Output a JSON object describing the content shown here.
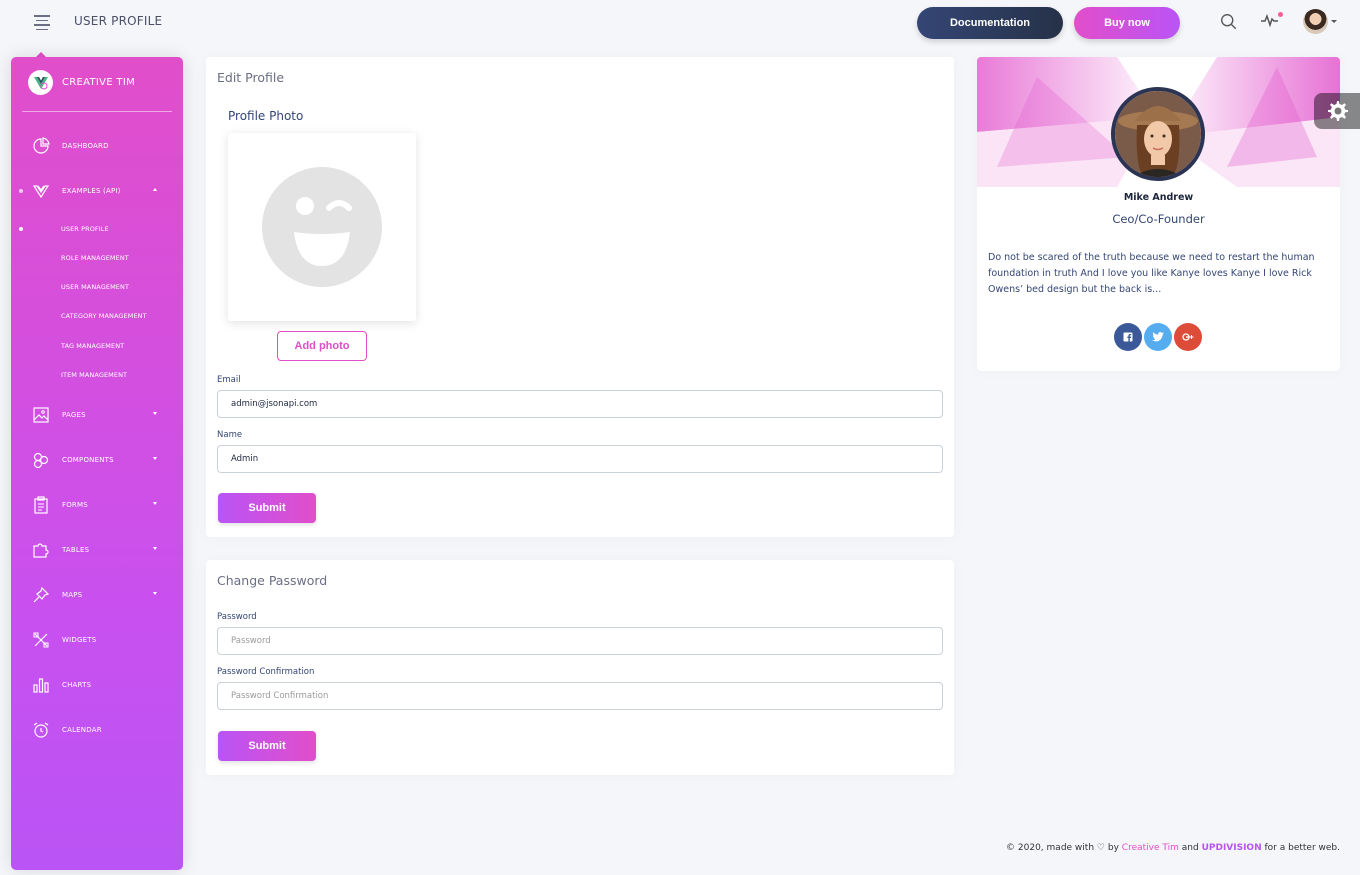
{
  "navbar": {
    "title": "USER PROFILE",
    "documentation_label": "Documentation",
    "buy_label": "Buy now"
  },
  "sidebar": {
    "brand": "CREATIVE TIM",
    "items": [
      {
        "label": "DASHBOARD",
        "icon": "chart-pie-icon"
      },
      {
        "label": "EXAMPLES (API)",
        "icon": "vue-logo-icon"
      },
      {
        "label": "PAGES",
        "icon": "image-icon"
      },
      {
        "label": "COMPONENTS",
        "icon": "components-icon"
      },
      {
        "label": "FORMS",
        "icon": "clipboard-icon"
      },
      {
        "label": "TABLES",
        "icon": "puzzle-icon"
      },
      {
        "label": "MAPS",
        "icon": "pin-icon"
      },
      {
        "label": "WIDGETS",
        "icon": "tools-icon"
      },
      {
        "label": "CHARTS",
        "icon": "bar-chart-icon"
      },
      {
        "label": "CALENDAR",
        "icon": "alarm-clock-icon"
      }
    ],
    "subitems": [
      {
        "label": "USER PROFILE"
      },
      {
        "label": "ROLE MANAGEMENT"
      },
      {
        "label": "USER MANAGEMENT"
      },
      {
        "label": "CATEGORY MANAGEMENT"
      },
      {
        "label": "TAG MANAGEMENT"
      },
      {
        "label": "ITEM MANAGEMENT"
      }
    ]
  },
  "edit_profile": {
    "title": "Edit Profile",
    "photo_label": "Profile Photo",
    "add_photo_label": "Add photo",
    "email_label": "Email",
    "email_value": "admin@jsonapi.com",
    "name_label": "Name",
    "name_value": "Admin",
    "submit_label": "Submit"
  },
  "change_password": {
    "title": "Change Password",
    "password_label": "Password",
    "password_placeholder": "Password",
    "confirm_label": "Password Confirmation",
    "confirm_placeholder": "Password Confirmation",
    "submit_label": "Submit"
  },
  "profile_card": {
    "name": "Mike Andrew",
    "role": "Ceo/Co-Founder",
    "description": "Do not be scared of the truth because we need to restart the human foundation in truth And I love you like Kanye loves Kanye I love Rick Owens’ bed design but the back is...",
    "social": [
      "facebook-icon",
      "twitter-icon",
      "google-plus-icon"
    ]
  },
  "footer": {
    "prefix": "© 2020, made with",
    "by": "by",
    "creative_tim": "Creative Tim",
    "and": "and",
    "updivision": "UPDIVISION",
    "suffix": "for a better web."
  },
  "colors": {
    "primary": "#e14eca",
    "secondary": "#ba54f5",
    "dark": "#344675"
  }
}
